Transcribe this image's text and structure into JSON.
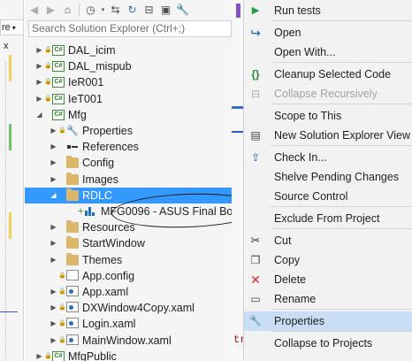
{
  "left_strip": {
    "file_dropdown": "re",
    "row_label": "x"
  },
  "toolbar": {
    "buttons": [
      "back",
      "forward",
      "home",
      "history",
      "sync",
      "refresh",
      "collapse",
      "show-all",
      "properties"
    ]
  },
  "search": {
    "placeholder": "Search Solution Explorer (Ctrl+;)"
  },
  "tree": [
    {
      "label": "DAL_icim",
      "icon": "csharp-project-icon",
      "expander": "collapsed",
      "locked": true
    },
    {
      "label": "DAL_mispub",
      "icon": "csharp-project-icon",
      "expander": "collapsed",
      "locked": true
    },
    {
      "label": "IeR001",
      "icon": "csharp-project-icon",
      "expander": "collapsed",
      "locked": true
    },
    {
      "label": "IeT001",
      "icon": "csharp-project-icon",
      "expander": "collapsed",
      "locked": true
    },
    {
      "label": "Mfg",
      "icon": "csharp-project-icon",
      "expander": "expanded",
      "locked": false
    },
    {
      "label": "Properties",
      "icon": "wrench-icon",
      "expander": "collapsed",
      "locked": true
    },
    {
      "label": "References",
      "icon": "references-icon",
      "expander": "collapsed",
      "locked": false
    },
    {
      "label": "Config",
      "icon": "folder-icon",
      "expander": "collapsed",
      "locked": false
    },
    {
      "label": "Images",
      "icon": "folder-icon",
      "expander": "collapsed",
      "locked": false
    },
    {
      "label": "RDLC",
      "icon": "folder-icon",
      "expander": "expanded",
      "locked": false,
      "selected": true
    },
    {
      "label": "MFG0096 - ASUS Final Bo",
      "icon": "report-icon",
      "expander": "none",
      "locked": false,
      "added": true
    },
    {
      "label": "Resources",
      "icon": "folder-icon",
      "expander": "collapsed",
      "locked": false
    },
    {
      "label": "StartWindow",
      "icon": "folder-icon",
      "expander": "collapsed",
      "locked": false
    },
    {
      "label": "Themes",
      "icon": "folder-icon",
      "expander": "collapsed",
      "locked": false
    },
    {
      "label": "App.config",
      "icon": "config-file-icon",
      "expander": "none",
      "locked": true
    },
    {
      "label": "App.xaml",
      "icon": "xaml-file-icon",
      "expander": "collapsed",
      "locked": true
    },
    {
      "label": "DXWindow4Copy.xaml",
      "icon": "xaml-file-icon",
      "expander": "collapsed",
      "locked": true
    },
    {
      "label": "Login.xaml",
      "icon": "xaml-file-icon",
      "expander": "collapsed",
      "locked": true
    },
    {
      "label": "MainWindow.xaml",
      "icon": "xaml-file-icon",
      "expander": "collapsed",
      "locked": true
    },
    {
      "label": "MfgPublic",
      "icon": "csharp-project-icon",
      "expander": "collapsed",
      "locked": true
    }
  ],
  "behind": {
    "code_fragment": "tr"
  },
  "context_menu": {
    "items": [
      {
        "label": "Run tests",
        "icon": "play-icon",
        "disabled": false
      },
      {
        "label": "Open",
        "icon": "open-arrow-icon",
        "disabled": false
      },
      {
        "label": "Open With...",
        "icon": "",
        "disabled": false
      },
      {
        "label": "Cleanup Selected Code",
        "icon": "braces-icon",
        "disabled": false
      },
      {
        "label": "Collapse Recursively",
        "icon": "collapse-icon",
        "disabled": true
      },
      {
        "label": "Scope to This",
        "icon": "",
        "disabled": false
      },
      {
        "label": "New Solution Explorer View",
        "icon": "new-view-icon",
        "disabled": false
      },
      {
        "label": "Check In...",
        "icon": "check-in-icon",
        "disabled": false
      },
      {
        "label": "Shelve Pending Changes",
        "icon": "",
        "disabled": false
      },
      {
        "label": "Source Control",
        "icon": "",
        "disabled": false
      },
      {
        "label": "Exclude From Project",
        "icon": "",
        "disabled": false
      },
      {
        "label": "Cut",
        "icon": "scissors-icon",
        "disabled": false
      },
      {
        "label": "Copy",
        "icon": "copy-icon",
        "disabled": false
      },
      {
        "label": "Delete",
        "icon": "delete-x-icon",
        "disabled": false
      },
      {
        "label": "Rename",
        "icon": "rename-icon",
        "disabled": false
      },
      {
        "label": "Properties",
        "icon": "wrench-icon",
        "disabled": false,
        "highlighted": true
      },
      {
        "label": "Collapse to Projects",
        "icon": "",
        "disabled": false
      }
    ]
  },
  "colors": {
    "selection": "#3399ff",
    "menu_highlight": "#c9def5",
    "menu_bg": "#f2f2f2",
    "panel_bg": "#f5f5f5",
    "run_green": "#1f9d3a",
    "delete_red": "#d32f2f"
  }
}
